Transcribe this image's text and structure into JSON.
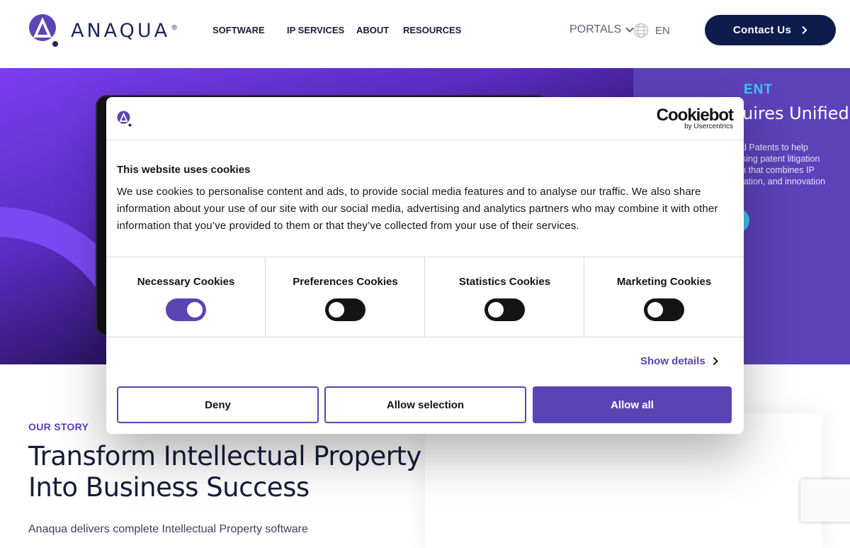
{
  "header": {
    "brand": "ANAQUA",
    "brand_reg": "®",
    "nav": [
      "SOFTWARE",
      "IP SERVICES",
      "ABOUT",
      "RESOURCES"
    ],
    "portals": "PORTALS",
    "lang": "EN",
    "contact": "Contact Us"
  },
  "hero": {
    "eyebrow": "ENT",
    "title": "uires Unified",
    "copy": [
      "ed Patents to help",
      "rising patent litigation",
      "ch that combines IP",
      "igation, and innovation"
    ]
  },
  "story": {
    "eyebrow": "OUR STORY",
    "title": [
      "Transform Intellectual Property",
      "Into Business Success"
    ],
    "body": "Anaqua delivers complete Intellectual Property software"
  },
  "cookie": {
    "brand": "Cookiebot",
    "brand_sub": "by Usercentrics",
    "title": "This website uses cookies",
    "text": "We use cookies to personalise content and ads, to provide social media features and to analyse our traffic. We also share information about your use of our site with our social media, advertising and analytics partners who may combine it with other information that you’ve provided to them or that they’ve collected from your use of their services.",
    "categories": [
      {
        "label": "Necessary Cookies",
        "on": true
      },
      {
        "label": "Preferences Cookies",
        "on": false
      },
      {
        "label": "Statistics Cookies",
        "on": false
      },
      {
        "label": "Marketing Cookies",
        "on": false
      }
    ],
    "details": "Show details",
    "deny": "Deny",
    "allow_selection": "Allow selection",
    "allow_all": "Allow all"
  },
  "colors": {
    "primary": "#5a44b4",
    "navy": "#0c1a4a",
    "accent": "#3fc3f0"
  }
}
